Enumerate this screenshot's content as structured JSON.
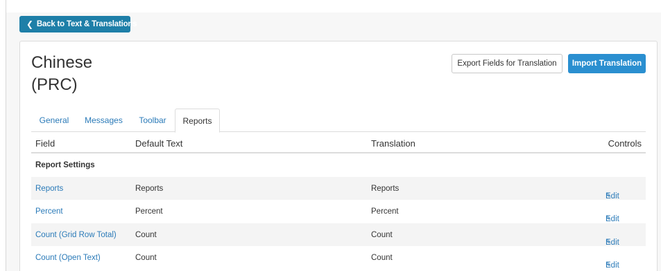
{
  "back_button": {
    "label": "Back to Text & Translations",
    "icon": "chevron-left-icon"
  },
  "page": {
    "title": "Chinese\n(PRC)"
  },
  "actions": {
    "export_label": "Export Fields for Translation",
    "import_label": "Import Translation"
  },
  "tabs": [
    {
      "label": "General",
      "active": false
    },
    {
      "label": "Messages",
      "active": false
    },
    {
      "label": "Toolbar",
      "active": false
    },
    {
      "label": "Reports",
      "active": true
    }
  ],
  "table": {
    "headers": {
      "field": "Field",
      "default_text": "Default Text",
      "translation": "Translation",
      "controls": "Controls"
    },
    "section": "Report Settings",
    "rows": [
      {
        "field": "Reports",
        "default_text": "Reports",
        "translation": "Reports",
        "control": "Edit"
      },
      {
        "field": "Percent",
        "default_text": "Percent",
        "translation": "Percent",
        "control": "Edit"
      },
      {
        "field": "Count (Grid Row Total)",
        "default_text": "Count",
        "translation": "Count",
        "control": "Edit"
      },
      {
        "field": "Count (Open Text)",
        "default_text": "Count",
        "translation": "Count",
        "control": "Edit"
      }
    ]
  },
  "colors": {
    "primary": "#1e7fa8",
    "import": "#2a8fd0",
    "link": "#2a7ab8",
    "stripe": "#f4f4f4"
  }
}
